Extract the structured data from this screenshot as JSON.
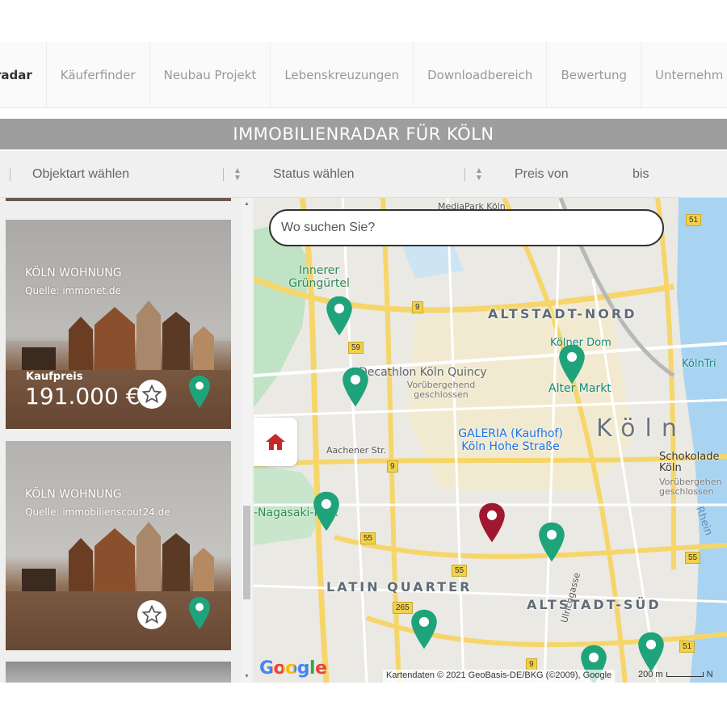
{
  "nav": {
    "items": [
      {
        "label": "radar",
        "active": true
      },
      {
        "label": "Käuferfinder"
      },
      {
        "label": "Neubau Projekt"
      },
      {
        "label": "Lebenskreuzungen"
      },
      {
        "label": "Downloadbereich"
      },
      {
        "label": "Bewertung"
      },
      {
        "label": "Unternehm"
      }
    ]
  },
  "page_title": "IMMOBILIENRADAR FÜR KÖLN",
  "filters": {
    "object_type": "Objektart wählen",
    "status": "Status wählen",
    "price_from": "Preis von",
    "price_to": "bis"
  },
  "listings": [
    {
      "city": "KÖLN WOHNUNG",
      "source": "Quelle: immonet.de",
      "price_label": "Kaufpreis",
      "price": "191.000 €"
    },
    {
      "city": "KÖLN WOHNUNG",
      "source": "Quelle: immobilienscout24.de"
    }
  ],
  "map": {
    "search_placeholder": "Wo suchen Sie?",
    "districts": [
      "ALTSTADT-NORD",
      "LATIN QUARTER",
      "ALTSTADT-SÜD",
      "Köln"
    ],
    "pois": {
      "gruenguertel": "Innerer Grüngürtel",
      "decathlon": "Decathlon Köln Quincy",
      "decathlon_note": "Vorübergehend geschlossen",
      "dom": "Kölner Dom",
      "altermarkt": "Alter Markt",
      "galeria": "GALERIA (Kaufhof) Köln Hohe Straße",
      "schokolade": "Schokolade Köln",
      "schokolade_note": "Vorübergehen geschlossen",
      "koelntri": "KölnTri",
      "nagasaki": "-Nagasaki-Park",
      "aachener": "Aachener Str.",
      "rhein": "Rhein",
      "ulrichgasse": "Ulrichgasse",
      "medienpark": "MediaPark Köln"
    },
    "road_numbers": [
      "51",
      "9",
      "59",
      "9",
      "55",
      "55",
      "265",
      "51",
      "9",
      "55"
    ],
    "google": "Google",
    "attribution": "Kartendaten © 2021 GeoBasis-DE/BKG (©2009), Google",
    "scale": "200 m",
    "scale_tail": "N"
  },
  "colors": {
    "pin_green": "#1fa37a",
    "pin_selected": "#a01830",
    "title_bar": "#9e9e9e",
    "home_icon": "#c62828"
  }
}
